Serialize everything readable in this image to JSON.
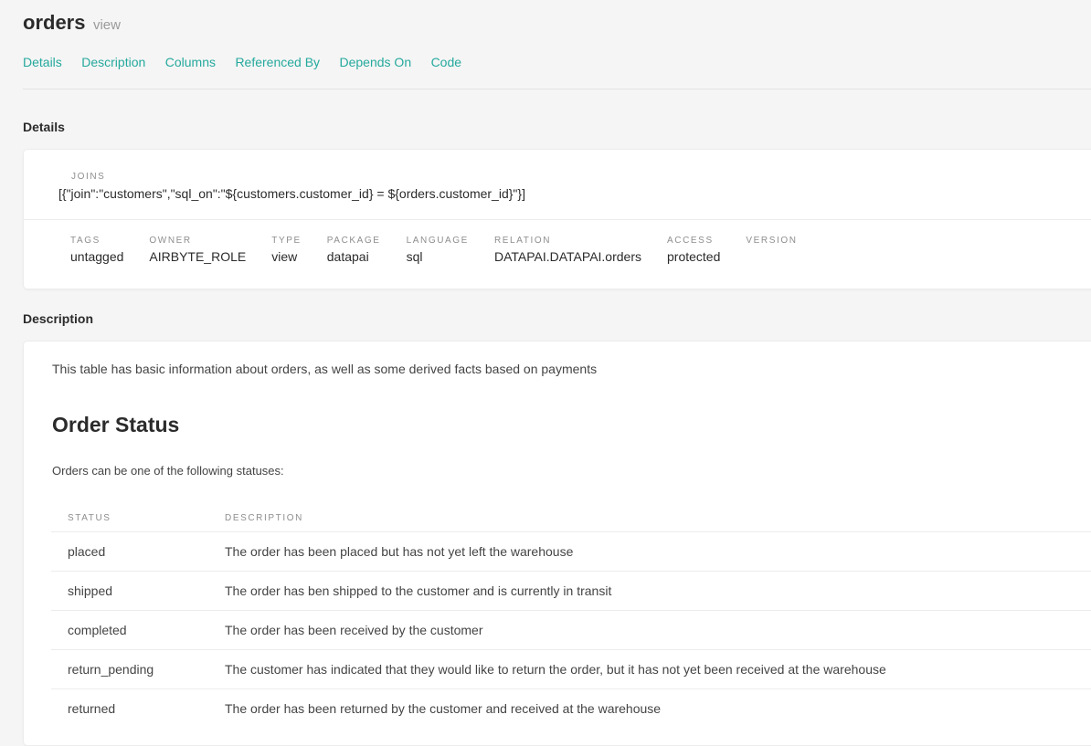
{
  "header": {
    "title": "orders",
    "subtitle": "view",
    "tabs": [
      "Details",
      "Description",
      "Columns",
      "Referenced By",
      "Depends On",
      "Code"
    ]
  },
  "details": {
    "heading": "Details",
    "joins_label": "JOINS",
    "joins_value": "[{\"join\":\"customers\",\"sql_on\":\"${customers.customer_id} = ${orders.customer_id}\"}]",
    "fields": [
      {
        "label": "TAGS",
        "value": "untagged"
      },
      {
        "label": "OWNER",
        "value": "AIRBYTE_ROLE"
      },
      {
        "label": "TYPE",
        "value": "view"
      },
      {
        "label": "PACKAGE",
        "value": "datapai"
      },
      {
        "label": "LANGUAGE",
        "value": "sql"
      },
      {
        "label": "RELATION",
        "value": "DATAPAI.DATAPAI.orders"
      },
      {
        "label": "ACCESS",
        "value": "protected"
      },
      {
        "label": "VERSION",
        "value": ""
      }
    ]
  },
  "description": {
    "heading": "Description",
    "intro": "This table has basic information about orders, as well as some derived facts based on payments",
    "section_title": "Order Status",
    "section_text": "Orders can be one of the following statuses:",
    "table": {
      "headers": [
        "STATUS",
        "DESCRIPTION"
      ],
      "rows": [
        [
          "placed",
          "The order has been placed but has not yet left the warehouse"
        ],
        [
          "shipped",
          "The order has ben shipped to the customer and is currently in transit"
        ],
        [
          "completed",
          "The order has been received by the customer"
        ],
        [
          "return_pending",
          "The customer has indicated that they would like to return the order, but it has not yet been received at the warehouse"
        ],
        [
          "returned",
          "The order has been returned by the customer and received at the warehouse"
        ]
      ]
    }
  },
  "colors": {
    "accent": "#25a99d",
    "background": "#f5f5f5"
  }
}
